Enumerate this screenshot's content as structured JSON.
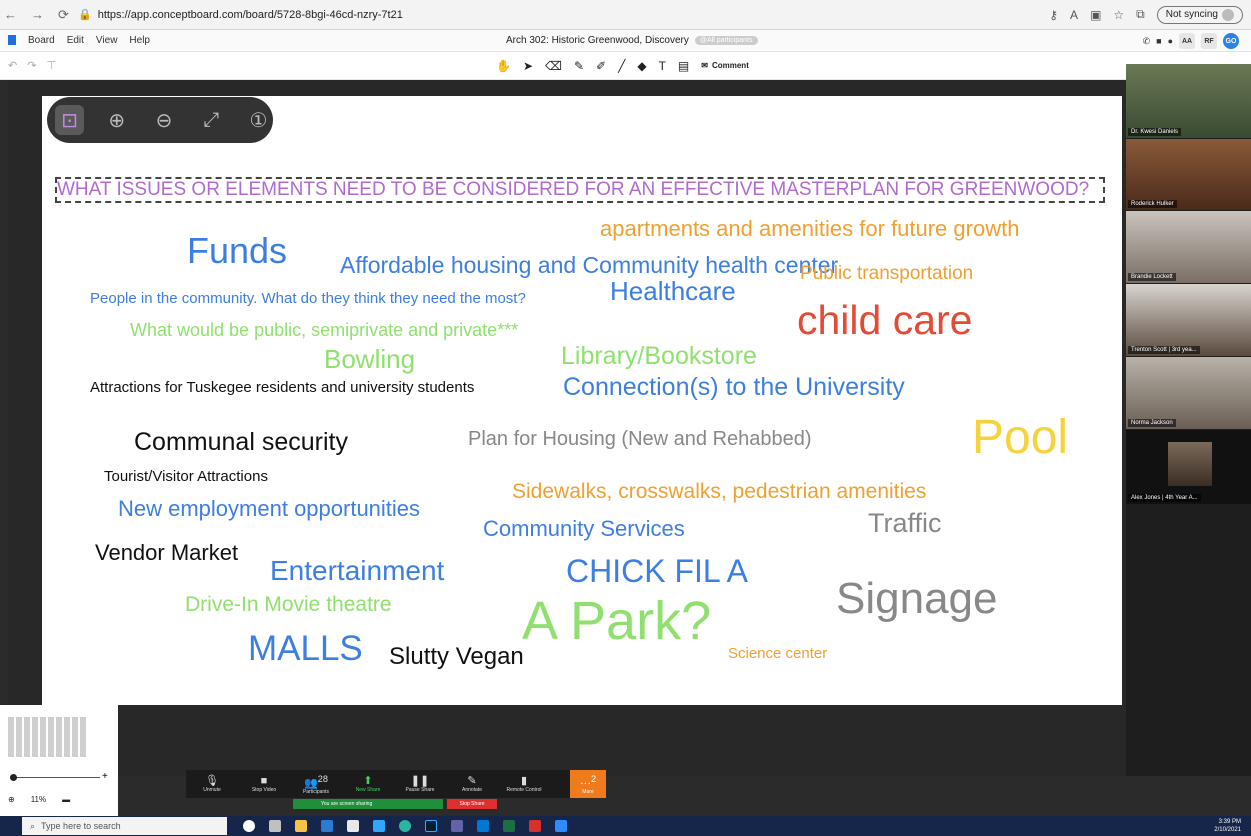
{
  "browser": {
    "url": "https://app.conceptboard.com/board/5728-8bgi-46cd-nzry-7t21",
    "sync_label": "Not syncing"
  },
  "app_menu": {
    "items": [
      "Board",
      "Edit",
      "View",
      "Help"
    ],
    "board_title": "Arch 302: Historic Greenwood, Discovery",
    "participants_badge": "@All participants",
    "avatars": [
      "AA",
      "RF",
      "GO"
    ]
  },
  "toolbar": {
    "comment_label": "Comment"
  },
  "zoom_overlay": {
    "icons": [
      "focus-icon",
      "zoom-in-icon",
      "zoom-out-icon",
      "fit-icon",
      "actual-size-icon"
    ]
  },
  "board": {
    "question": "WHAT ISSUES OR ELEMENTS NEED TO BE CONSIDERED FOR AN EFFECTIVE MASTERPLAN  FOR GREENWOOD?",
    "words": [
      {
        "text": "apartments and amenities for future growth",
        "color": "#f0a030"
      },
      {
        "text": "Funds",
        "color": "#3d7ee3"
      },
      {
        "text": "Affordable housing and Community health center",
        "color": "#3d7ee3"
      },
      {
        "text": "Public transportation",
        "color": "#f0a030"
      },
      {
        "text": "People in the community. What do they think they need the most?",
        "color": "#3d7ee3"
      },
      {
        "text": "Healthcare",
        "color": "#3d7ee3"
      },
      {
        "text": "What would be public, semiprivate and private***",
        "color": "#8fe06e"
      },
      {
        "text": "child care",
        "color": "#e24b35"
      },
      {
        "text": "Bowling",
        "color": "#8fe06e"
      },
      {
        "text": "Library/Bookstore",
        "color": "#8fe06e"
      },
      {
        "text": "Attractions for Tuskegee residents and university students",
        "color": "#111111"
      },
      {
        "text": "Connection(s) to the University",
        "color": "#3d7ee3"
      },
      {
        "text": "Communal security",
        "color": "#111111"
      },
      {
        "text": "Plan for Housing (New and Rehabbed)",
        "color": "#888888"
      },
      {
        "text": "Pool",
        "color": "#f6d23c"
      },
      {
        "text": "Tourist/Visitor Attractions",
        "color": "#111111"
      },
      {
        "text": "Sidewalks, crosswalks, pedestrian amenities",
        "color": "#f0a030"
      },
      {
        "text": "New employment opportunities",
        "color": "#3d7ee3"
      },
      {
        "text": "Community Services",
        "color": "#3d7ee3"
      },
      {
        "text": "Traffic",
        "color": "#888888"
      },
      {
        "text": "Vendor Market",
        "color": "#111111"
      },
      {
        "text": "Entertainment",
        "color": "#3d7ee3"
      },
      {
        "text": "CHICK FIL A",
        "color": "#3d7ee3"
      },
      {
        "text": "Signage",
        "color": "#888888"
      },
      {
        "text": "Drive-In Movie theatre",
        "color": "#8fe06e"
      },
      {
        "text": "A Park?",
        "color": "#8fe06e"
      },
      {
        "text": "MALLS",
        "color": "#3d7ee3"
      },
      {
        "text": "Slutty Vegan",
        "color": "#111111"
      },
      {
        "text": "Science center",
        "color": "#f0a030"
      }
    ]
  },
  "participants": [
    {
      "name": "Dr. Kwesi Daniels"
    },
    {
      "name": "Roderick Hulker"
    },
    {
      "name": "Brandie Lockett"
    },
    {
      "name": "Trenton Scott | 3rd yea..."
    },
    {
      "name": "Norma Jackson"
    },
    {
      "name": "Alex Jones | 4th Year A..."
    }
  ],
  "zoom_level": "11%",
  "meeting_controls": {
    "unmute": "Unmute",
    "stop_video": "Stop Video",
    "participants": "Participants",
    "participants_count": "28",
    "new_share": "New Share",
    "pause_share": "Pause Share",
    "annotate": "Annotate",
    "remote_control": "Remote Control",
    "more": "More",
    "more_count": "2",
    "sharing_status": "You are screen sharing",
    "stop_share": "Stop Share"
  },
  "taskbar": {
    "search_placeholder": "Type here to search",
    "time": "3:39 PM",
    "date": "2/10/2021"
  },
  "colors": {
    "accent_purple": "#b06ad0",
    "board_bg": "#ffffff",
    "meeting_green": "#1f8f3c",
    "meeting_more": "#f07b1d"
  }
}
